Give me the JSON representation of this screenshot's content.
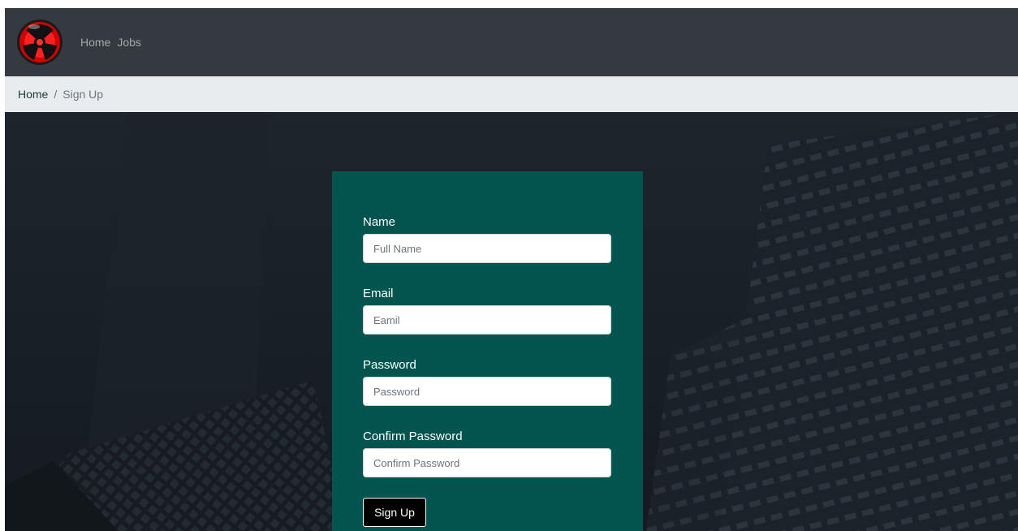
{
  "navbar": {
    "logo_icon": "red-tri-blade-logo-icon",
    "links": [
      "Home",
      "Jobs"
    ]
  },
  "breadcrumb": {
    "home": "Home",
    "separator": "/",
    "current": "Sign Up"
  },
  "form": {
    "fields": [
      {
        "label": "Name",
        "placeholder": "Full Name",
        "value": ""
      },
      {
        "label": "Email",
        "placeholder": "Eamil",
        "value": ""
      },
      {
        "label": "Password",
        "placeholder": "Password",
        "value": ""
      },
      {
        "label": "Confirm Password",
        "placeholder": "Confirm Password",
        "value": ""
      }
    ],
    "submit_label": "Sign Up"
  },
  "colors": {
    "navbar_bg": "#343a40",
    "breadcrumb_bg": "#e9ecef",
    "card_bg": "#02554f",
    "hero_bg": "#1a2129",
    "button_bg": "#000000"
  }
}
